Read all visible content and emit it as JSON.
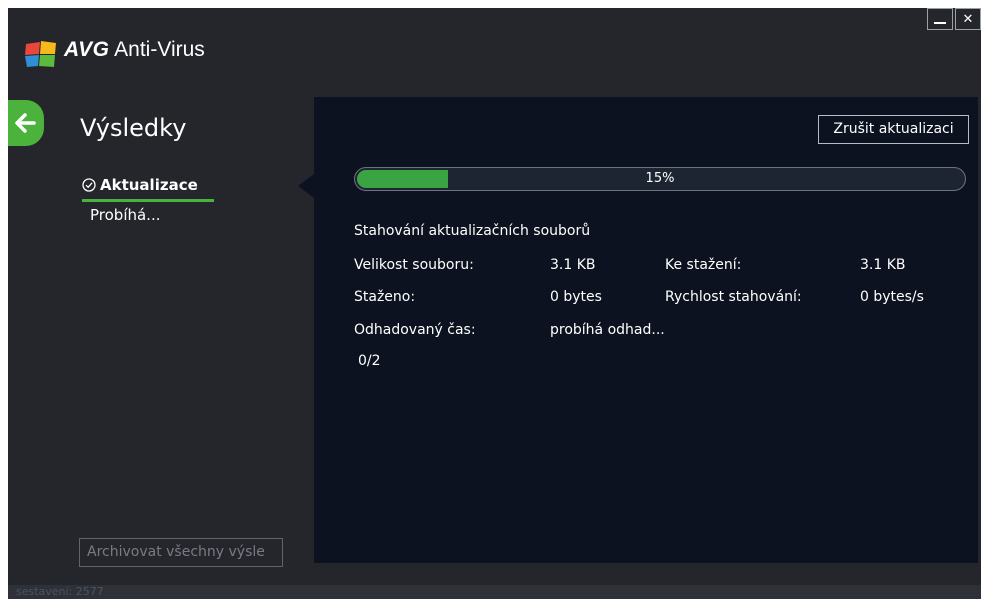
{
  "app": {
    "brand": "AVG",
    "product": "Anti-Virus",
    "accent_color": "#4bb23b"
  },
  "window_controls": {
    "minimize_icon": "minimize-icon",
    "close_glyph": "✕"
  },
  "sidebar": {
    "back_icon": "arrow-left-icon",
    "title": "Výsledky",
    "items": [
      {
        "label": "Aktualizace",
        "status": "Probíhá...",
        "icon": "check-circle-icon",
        "selected": true
      }
    ],
    "archive_button": "Archivovat všechny výsle"
  },
  "main": {
    "cancel_button": "Zrušit aktualizaci",
    "progress": {
      "percent": 15,
      "text": "15%"
    },
    "description": "Stahování aktualizačních souborů",
    "info": {
      "file_size_label": "Velikost souboru:",
      "file_size_value": "3.1 KB",
      "to_download_label": "Ke stažení:",
      "to_download_value": "3.1 KB",
      "downloaded_label": "Staženo:",
      "downloaded_value": "0 bytes",
      "speed_label": "Rychlost stahování:",
      "speed_value": "0 bytes/s",
      "eta_label": "Odhadovaný čas:",
      "eta_value": "probíhá odhad..."
    },
    "counter": "0/2"
  },
  "statusbar": {
    "build_text": "sestavení: 2577"
  }
}
